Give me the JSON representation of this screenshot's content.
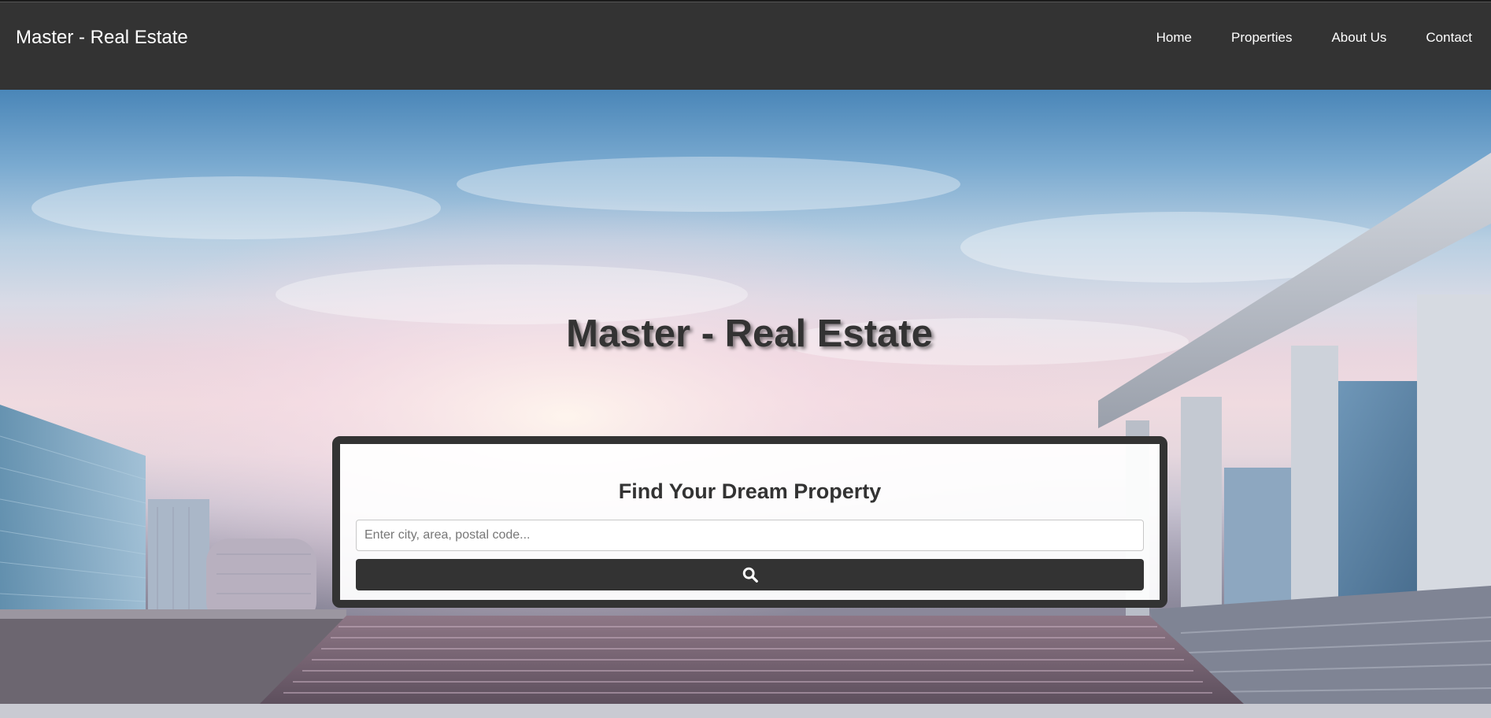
{
  "navbar": {
    "brand": "Master - Real Estate",
    "links": [
      {
        "label": "Home"
      },
      {
        "label": "Properties"
      },
      {
        "label": "About Us"
      },
      {
        "label": "Contact"
      }
    ]
  },
  "hero": {
    "title": "Master - Real Estate"
  },
  "search": {
    "heading": "Find Your Dream Property",
    "placeholder": "Enter city, area, postal code...",
    "value": "",
    "button_icon": "search-icon"
  },
  "colors": {
    "navbar_bg": "#333333",
    "text_dark": "#333333",
    "text_light": "#ffffff"
  }
}
